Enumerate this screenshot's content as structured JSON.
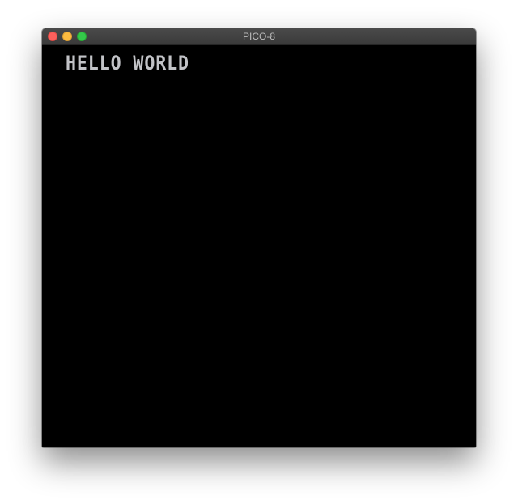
{
  "window": {
    "title": "PICO-8"
  },
  "console": {
    "output": "HELLO WORLD",
    "text_color": "#c2c3c7",
    "background_color": "#000000"
  },
  "titlebar_buttons": {
    "close_color": "#fc605c",
    "minimize_color": "#fdbc40",
    "zoom_color": "#34c84a"
  }
}
